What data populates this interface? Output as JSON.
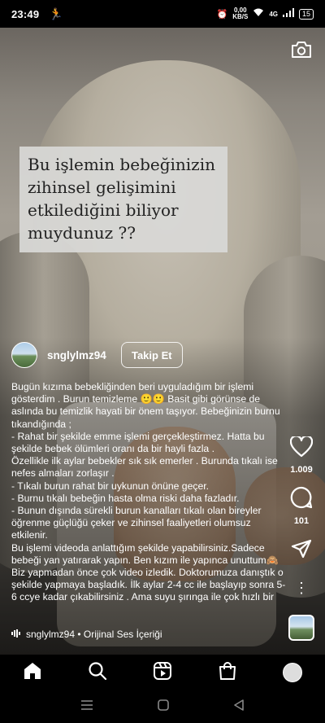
{
  "status_bar": {
    "time": "23:49",
    "speed_value": "0,00",
    "speed_unit": "KB/S",
    "network": "4G",
    "battery": "15"
  },
  "overlay": {
    "text": "Bu işlemin bebeğinizin zihinsel gelişimini etkilediğini biliyor muydunuz ??"
  },
  "author": {
    "username": "snglylmz94",
    "follow_label": "Takip Et"
  },
  "caption": {
    "lines": [
      "Bugün kızıma bebekliğinden beri uyguladığım bir işlemi gösterdim . Burun temizleme 🙂🙂 Basit gibi görünse de aslında bu temizlik hayati bir önem taşıyor. Bebeğinizin burnu tıkandığında ;",
      "- Rahat bir şekilde emme işlemi gerçekleştirmez. Hatta bu şekilde bebek ölümleri oranı da bir hayli fazla .",
      "Özellikle ilk aylar bebekler sık sık emerler . Burunda tıkalı ise nefes almaları zorlaşır .",
      "- Tıkalı burun rahat bir uykunun önüne geçer.",
      "- Burnu tıkalı bebeğin hasta olma riski daha fazladır.",
      "- Bunun dışında sürekli burun kanalları tıkalı olan bireyler öğrenme güçlüğü çeker  ve zihinsel faaliyetleri olumsuz etkilenir.",
      "Bu işlemi videoda anlattığım şekilde yapabilirsiniz.Sadece bebeği yan yatırarak yapın. Ben kızım ile yapınca unuttum🙈 Biz yapmadan önce çok video izledik. Doktorumuza danıştık o şekilde yapmaya başladık. İlk aylar 2-4 cc ile başlayıp sonra 5-6 ccye kadar çıkabilirsiniz . Ama suyu şırınga ile çok hızlı bir"
    ]
  },
  "audio": {
    "label": "snglylmz94 • Orijinal Ses İçeriği"
  },
  "actions": {
    "likes": "1.009",
    "comments": "101"
  },
  "colors": {
    "background": "#000000",
    "overlay_box": "#d8d8d6",
    "text": "#ffffff"
  }
}
